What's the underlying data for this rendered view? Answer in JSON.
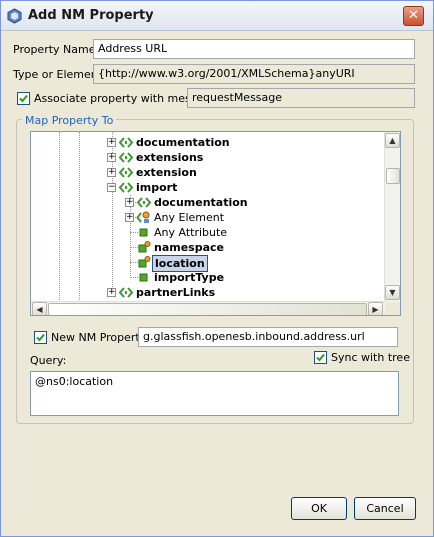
{
  "window": {
    "title": "Add NM Property",
    "close_label": "✕"
  },
  "form": {
    "property_name_label": "Property Name:",
    "property_name_value": "Address URL",
    "type_label": "Type or Element:",
    "type_value": "{http://www.w3.org/2001/XMLSchema}anyURI",
    "associate_label": "Associate property with message",
    "associate_checked": true,
    "message_value": "requestMessage"
  },
  "map_group": {
    "title": "Map Property To",
    "tree": [
      {
        "label": "documentation",
        "bold": true,
        "depth": 0,
        "expander": "+",
        "icon": "element-pair-icon"
      },
      {
        "label": "extensions",
        "bold": true,
        "depth": 0,
        "expander": "+",
        "icon": "element-pair-icon"
      },
      {
        "label": "extension",
        "bold": true,
        "depth": 0,
        "expander": "+",
        "icon": "element-pair-icon"
      },
      {
        "label": "import",
        "bold": true,
        "depth": 0,
        "expander": "-",
        "icon": "element-pair-icon"
      },
      {
        "label": "documentation",
        "bold": true,
        "depth": 1,
        "expander": "+",
        "icon": "element-pair-icon"
      },
      {
        "label": "Any Element",
        "bold": false,
        "depth": 1,
        "expander": "+",
        "icon": "any-element-icon"
      },
      {
        "label": "Any Attribute",
        "bold": false,
        "depth": 1,
        "expander": "",
        "icon": "attribute-icon"
      },
      {
        "label": "namespace",
        "bold": true,
        "depth": 1,
        "expander": "",
        "icon": "attribute-key-icon"
      },
      {
        "label": "location",
        "bold": true,
        "depth": 1,
        "expander": "",
        "icon": "attribute-key-icon",
        "selected": true
      },
      {
        "label": "importType",
        "bold": true,
        "depth": 1,
        "expander": "",
        "icon": "attribute-icon"
      },
      {
        "label": "partnerLinks",
        "bold": true,
        "depth": 0,
        "expander": "+",
        "icon": "element-pair-icon"
      }
    ],
    "new_property_label": "New NM Property:",
    "new_property_checked": true,
    "new_property_value": "g.glassfish.openesb.inbound.address.url",
    "query_label": "Query:",
    "sync_label": "Sync with tree",
    "sync_checked": true,
    "query_value": "@ns0:location"
  },
  "buttons": {
    "ok": "OK",
    "cancel": "Cancel"
  },
  "colors": {
    "accent": "#1c64c8",
    "selection": "#c9d6ea",
    "element_icon": "#3a9a2e",
    "attribute_icon": "#4fa82c"
  }
}
